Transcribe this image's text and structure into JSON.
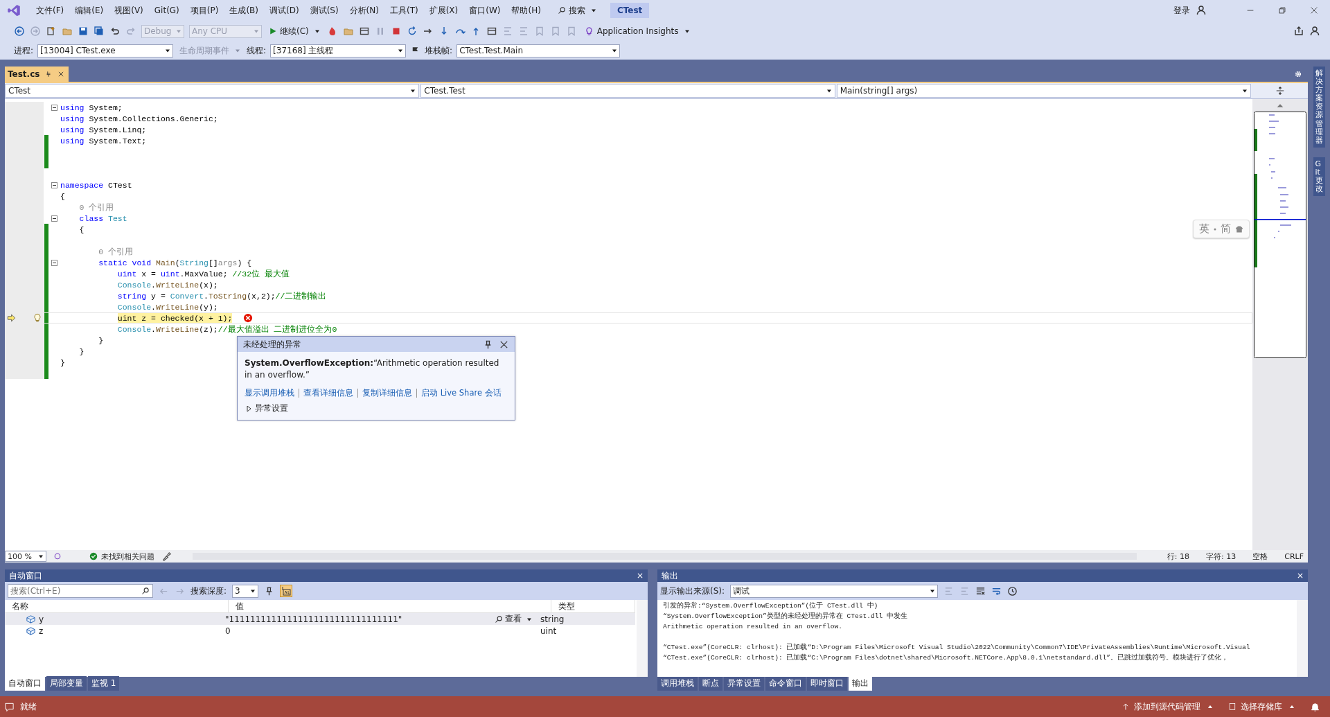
{
  "menu": {
    "items": [
      "文件(F)",
      "编辑(E)",
      "视图(V)",
      "Git(G)",
      "项目(P)",
      "生成(B)",
      "调试(D)",
      "测试(S)",
      "分析(N)",
      "工具(T)",
      "扩展(X)",
      "窗口(W)",
      "帮助(H)"
    ],
    "search": "搜索",
    "solution": "CTest",
    "login": "登录"
  },
  "toolbar": {
    "config": {
      "label": "Debug",
      "disabled": true
    },
    "platform": {
      "label": "Any CPU",
      "disabled": true
    },
    "continue": "继续(C)",
    "insights": "Application Insights"
  },
  "debug_bar": {
    "process_label": "进程:",
    "process": "[13004] CTest.exe",
    "lifecycle": "生命周期事件",
    "thread_label": "线程:",
    "thread": "[37168] 主线程",
    "stack_label": "堆栈帧:",
    "stack": "CTest.Test.Main"
  },
  "document_tabs": [
    {
      "label": "Test.cs",
      "selected": true
    }
  ],
  "nav_bar": [
    "CTest",
    "CTest.Test",
    "Main(string[] args)"
  ],
  "code_lines": [
    {
      "fold": true,
      "changed": false,
      "tokens": [
        {
          "text": "using",
          "kind": "keyword"
        },
        {
          "text": " System;",
          "kind": "plain"
        }
      ]
    },
    {
      "fold": false,
      "changed": false,
      "tokens": [
        {
          "text": "using",
          "kind": "keyword"
        },
        {
          "text": " System.Collections.Generic;",
          "kind": "plain"
        }
      ]
    },
    {
      "fold": false,
      "changed": false,
      "tokens": [
        {
          "text": "using",
          "kind": "keyword"
        },
        {
          "text": " System.Linq;",
          "kind": "plain"
        }
      ]
    },
    {
      "fold": false,
      "changed": true,
      "tokens": [
        {
          "text": "using",
          "kind": "keyword"
        },
        {
          "text": " System.Text;",
          "kind": "plain"
        }
      ]
    },
    {
      "fold": false,
      "changed": true
    },
    {
      "fold": false,
      "changed": true
    },
    {
      "fold": false,
      "changed": false
    },
    {
      "fold": true,
      "changed": false,
      "tokens": [
        {
          "text": "namespace",
          "kind": "keyword"
        },
        {
          "text": " CTest",
          "kind": "plain"
        }
      ]
    },
    {
      "fold": false,
      "changed": false,
      "tokens": [
        {
          "text": "{",
          "kind": "plain"
        }
      ],
      "children": [
        {
          "fold": false,
          "changed": false,
          "tokens": [
            {
              "text": "0 个引用",
              "kind": "lens"
            }
          ]
        },
        {
          "fold": true,
          "changed": false,
          "tokens": [
            {
              "text": "class",
              "kind": "keyword"
            },
            {
              "text": " Test",
              "kind": "type"
            }
          ]
        },
        {
          "fold": false,
          "changed": true,
          "tokens": [
            {
              "text": "{",
              "kind": "plain"
            }
          ],
          "children": [
            {
              "fold": false,
              "changed": true
            },
            {
              "fold": false,
              "changed": true,
              "tokens": [
                {
                  "text": "0 个引用",
                  "kind": "lens"
                }
              ]
            },
            {
              "fold": true,
              "changed": true,
              "tokens": [
                {
                  "text": "static void",
                  "kind": "keyword"
                },
                {
                  "text": " Main",
                  "kind": "method"
                },
                {
                  "text": "(",
                  "kind": "plain"
                },
                {
                  "text": "String",
                  "kind": "type"
                },
                {
                  "text": "[]",
                  "kind": "plain"
                },
                {
                  "text": "args",
                  "kind": "param"
                },
                {
                  "text": ") {",
                  "kind": "plain"
                }
              ],
              "children": [
                {
                  "fold": false,
                  "changed": true,
                  "tokens": [
                    {
                      "text": "uint",
                      "kind": "keyword"
                    },
                    {
                      "text": " x = ",
                      "kind": "plain"
                    },
                    {
                      "text": "uint",
                      "kind": "keyword"
                    },
                    {
                      "text": ".MaxValue; ",
                      "kind": "plain"
                    },
                    {
                      "text": "//32位 最大值",
                      "kind": "comment"
                    }
                  ]
                },
                {
                  "fold": false,
                  "changed": true,
                  "tokens": [
                    {
                      "text": "Console",
                      "kind": "type"
                    },
                    {
                      "text": ".",
                      "kind": "plain"
                    },
                    {
                      "text": "WriteLine",
                      "kind": "method"
                    },
                    {
                      "text": "(x);",
                      "kind": "plain"
                    }
                  ]
                },
                {
                  "fold": false,
                  "changed": true,
                  "tokens": [
                    {
                      "text": "string",
                      "kind": "keyword"
                    },
                    {
                      "text": " y = ",
                      "kind": "plain"
                    },
                    {
                      "text": "Convert",
                      "kind": "type"
                    },
                    {
                      "text": ".",
                      "kind": "plain"
                    },
                    {
                      "text": "ToString",
                      "kind": "method"
                    },
                    {
                      "text": "(x,2);",
                      "kind": "plain"
                    },
                    {
                      "text": "//二进制输出",
                      "kind": "comment"
                    }
                  ]
                },
                {
                  "fold": false,
                  "changed": true,
                  "tokens": [
                    {
                      "text": "Console",
                      "kind": "type"
                    },
                    {
                      "text": ".",
                      "kind": "plain"
                    },
                    {
                      "text": "WriteLine",
                      "kind": "method"
                    },
                    {
                      "text": "(y);",
                      "kind": "plain"
                    }
                  ]
                },
                {
                  "fold": false,
                  "changed": true,
                  "current": true,
                  "error": true,
                  "tokens": [
                    {
                      "text": "uint z = checked(x + 1);",
                      "kind": "plain"
                    }
                  ]
                },
                {
                  "fold": false,
                  "changed": true,
                  "tokens": [
                    {
                      "text": "Console",
                      "kind": "type"
                    },
                    {
                      "text": ".",
                      "kind": "plain"
                    },
                    {
                      "text": "WriteLine",
                      "kind": "method"
                    },
                    {
                      "text": "(z);",
                      "kind": "plain"
                    },
                    {
                      "text": "//最大值溢出 二进制进位全为0",
                      "kind": "comment"
                    }
                  ]
                }
              ]
            },
            {
              "fold": false,
              "changed": true,
              "tokens": [
                {
                  "text": "}",
                  "kind": "plain"
                }
              ]
            }
          ]
        },
        {
          "fold": false,
          "changed": true,
          "tokens": [
            {
              "text": "}",
              "kind": "plain"
            }
          ]
        }
      ]
    },
    {
      "fold": false,
      "changed": true,
      "tokens": [
        {
          "text": "}",
          "kind": "plain"
        }
      ]
    },
    {
      "fold": false,
      "changed": true
    }
  ],
  "exception_popup": {
    "title": "未经处理的异常",
    "message": "**System.OverflowException:**“Arithmetic operation resulted in an overflow.”",
    "links": [
      "显示调用堆栈",
      "查看详细信息",
      "复制详细信息",
      "启动 Live Share 会话"
    ],
    "settings": {
      "label": "异常设置",
      "expanded": false
    }
  },
  "ime_widget": [
    "英",
    "简"
  ],
  "editor_status": {
    "zoom": "100 %",
    "issues": "未找到相关问题",
    "line": "行: 18",
    "char": "字符: 13",
    "whitespace": "空格",
    "eol": "CRLF"
  },
  "side_tabs": [
    "解决方案资源管理器",
    "Git 更改"
  ],
  "autos": {
    "title": "自动窗口",
    "search_placeholder": "搜索(Ctrl+E)",
    "depth_label": "搜索深度:",
    "depth": "3",
    "columns": [
      "名称",
      "值",
      "类型"
    ],
    "rows": [
      {
        "name": "y",
        "value": "\"11111111111111111111111111111111\"",
        "view": "查看",
        "type": "string",
        "selected": true
      },
      {
        "name": "z",
        "value": "0",
        "type": "uint",
        "selected": false
      }
    ],
    "tabs": [
      {
        "label": "自动窗口",
        "selected": true
      },
      {
        "label": "局部变量",
        "selected": false
      },
      {
        "label": "监视 1",
        "selected": false
      }
    ]
  },
  "output": {
    "title": "输出",
    "source_label": "显示输出来源(S):",
    "source": "调试",
    "lines": [
      "引发的异常:“System.OverflowException”(位于 CTest.dll 中)",
      "“System.OverflowException”类型的未经处理的异常在 CTest.dll 中发生",
      "Arithmetic operation resulted in an overflow.",
      "“CTest.exe”(CoreCLR: clrhost): 已加载“D:\\Program Files\\Microsoft Visual Studio\\2022\\Community\\Common7\\IDE\\PrivateAssemblies\\Runtime\\Microsoft.Visual",
      "“CTest.exe”(CoreCLR: clrhost): 已加载“C:\\Program Files\\dotnet\\shared\\Microsoft.NETCore.App\\8.0.1\\netstandard.dll”。已跳过加载符号。模块进行了优化，"
    ],
    "tabs": [
      {
        "label": "调用堆栈",
        "selected": false
      },
      {
        "label": "断点",
        "selected": false
      },
      {
        "label": "异常设置",
        "selected": false
      },
      {
        "label": "命令窗口",
        "selected": false
      },
      {
        "label": "即时窗口",
        "selected": false
      },
      {
        "label": "输出",
        "selected": true
      }
    ]
  },
  "status_bar": {
    "ready": "就绪",
    "source_control": "添加到源代码管理",
    "repo": "选择存储库"
  }
}
